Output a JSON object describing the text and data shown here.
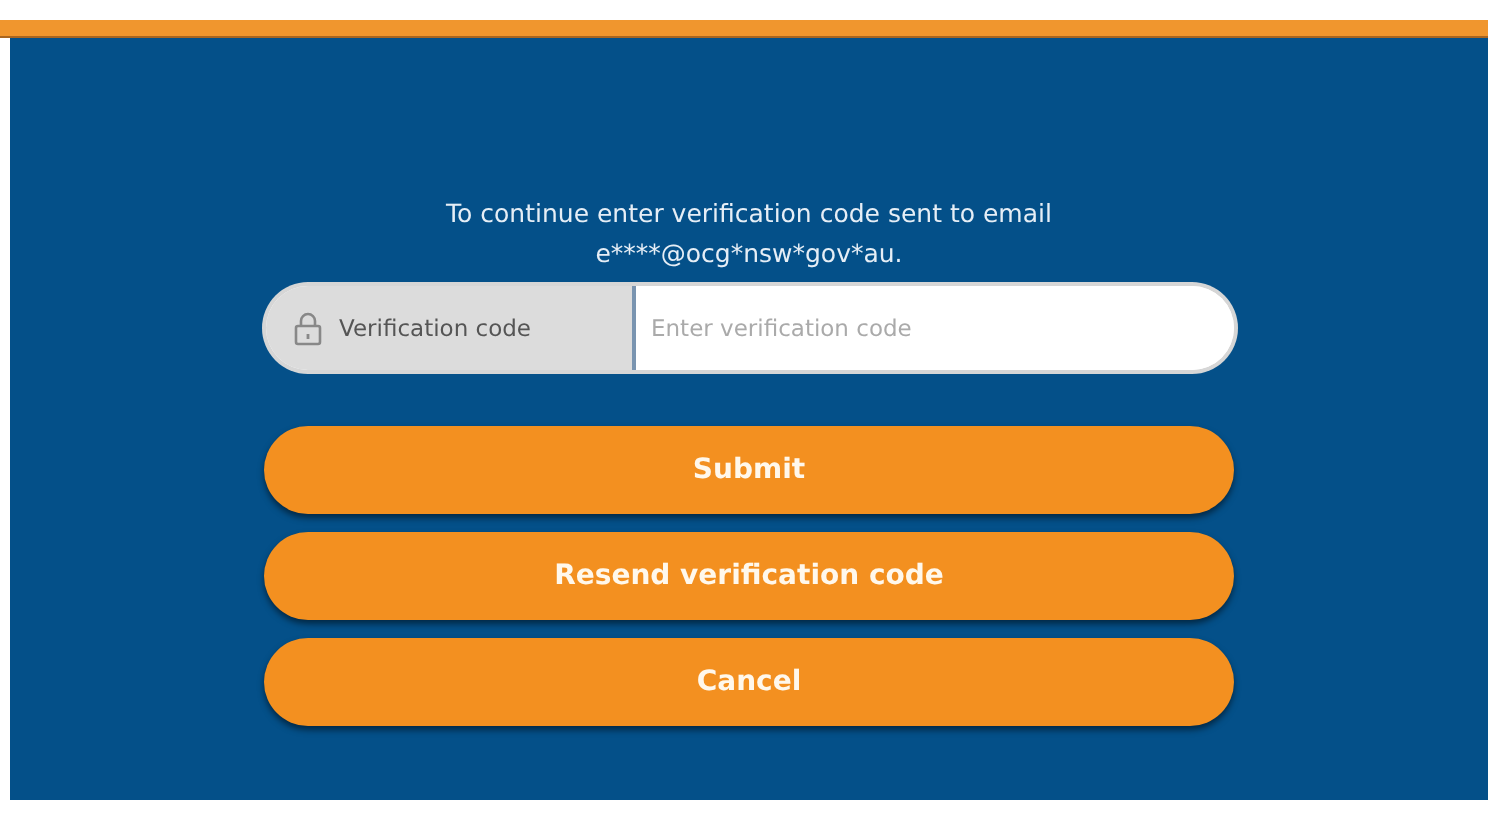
{
  "message": {
    "line_1": "To continue enter verification code sent to email",
    "line_2": "e****@ocg*nsw*gov*au."
  },
  "code_field": {
    "label": "Verification code",
    "placeholder": "Enter verification code"
  },
  "buttons": [
    "Submit",
    "Resend verification code",
    "Cancel"
  ]
}
